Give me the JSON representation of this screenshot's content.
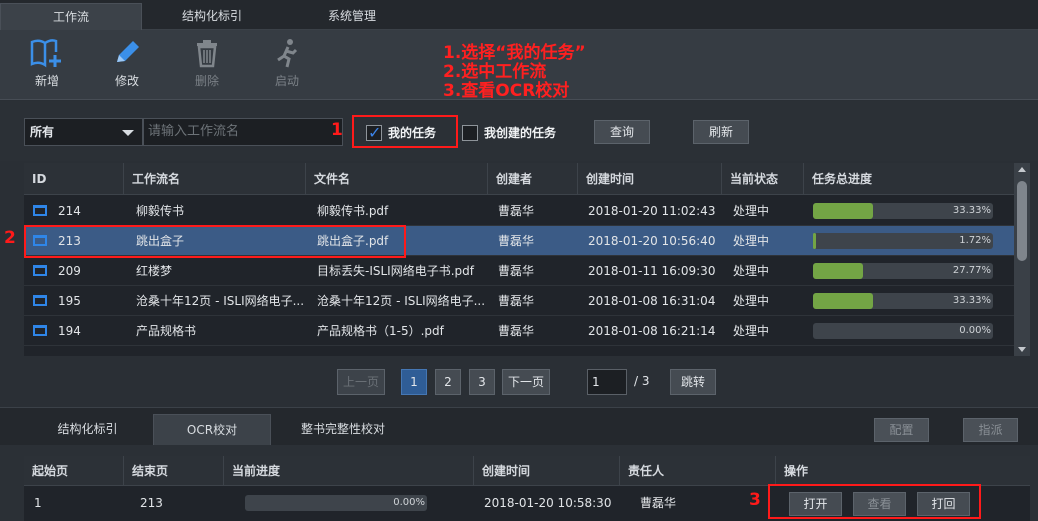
{
  "tabs": [
    "工作流",
    "结构化标引",
    "系统管理"
  ],
  "toolbar": {
    "add": "新增",
    "edit": "修改",
    "delete": "删除",
    "start": "启动"
  },
  "annotation": {
    "line1": "1.选择“我的任务”",
    "line2": "2.选中工作流",
    "line3": "3.查看OCR校对",
    "n1": "1",
    "n2": "2",
    "n3": "3"
  },
  "filter": {
    "scope_value": "所有",
    "search_placeholder": "请输入工作流名",
    "my_tasks": "我的任务",
    "my_created": "我创建的任务",
    "query": "查询",
    "refresh": "刷新"
  },
  "table": {
    "columns": [
      "ID",
      "工作流名",
      "文件名",
      "创建者",
      "创建时间",
      "当前状态",
      "任务总进度"
    ],
    "rows": [
      {
        "id": "214",
        "name": "柳毅传书",
        "file": "柳毅传书.pdf",
        "creator": "曹磊华",
        "time": "2018-01-20 11:02:43",
        "status": "处理中",
        "progress": 33.33,
        "progress_text": "33.33%"
      },
      {
        "id": "213",
        "name": "跳出盒子",
        "file": "跳出盒子.pdf",
        "creator": "曹磊华",
        "time": "2018-01-20 10:56:40",
        "status": "处理中",
        "progress": 1.72,
        "progress_text": "1.72%"
      },
      {
        "id": "209",
        "name": "红楼梦",
        "file": "目标丢失-ISLI网络电子书.pdf",
        "creator": "曹磊华",
        "time": "2018-01-11 16:09:30",
        "status": "处理中",
        "progress": 27.77,
        "progress_text": "27.77%"
      },
      {
        "id": "195",
        "name": "沧桑十年12页 - ISLI网络电子...",
        "file": "沧桑十年12页 - ISLI网络电子...",
        "creator": "曹磊华",
        "time": "2018-01-08 16:31:04",
        "status": "处理中",
        "progress": 33.33,
        "progress_text": "33.33%"
      },
      {
        "id": "194",
        "name": "产品规格书",
        "file": "产品规格书（1-5）.pdf",
        "creator": "曹磊华",
        "time": "2018-01-08 16:21:14",
        "status": "处理中",
        "progress": 0.0,
        "progress_text": "0.00%"
      }
    ]
  },
  "pager": {
    "prev": "上一页",
    "p1": "1",
    "p2": "2",
    "p3": "3",
    "next": "下一页",
    "current": "1",
    "total": "/ 3",
    "jump": "跳转"
  },
  "lower": {
    "tabs": [
      "结构化标引",
      "OCR校对",
      "整书完整性校对"
    ],
    "config": "配置",
    "assign": "指派",
    "columns": [
      "起始页",
      "结束页",
      "当前进度",
      "创建时间",
      "责任人",
      "操作"
    ],
    "row": {
      "start": "1",
      "end": "213",
      "progress": 0.0,
      "progress_text": "0.00%",
      "time": "2018-01-20 10:58:30",
      "owner": "曹磊华"
    },
    "actions": {
      "open": "打开",
      "view": "查看",
      "back": "打回"
    }
  },
  "colors": {
    "accent": "#2f86e8",
    "selected_row": "#3b5b86",
    "progress_fill": "#73a545",
    "annotation": "#ff1a1a"
  }
}
